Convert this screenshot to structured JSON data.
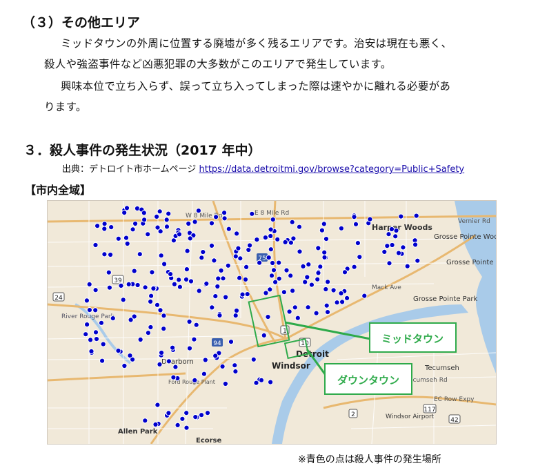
{
  "section3": {
    "heading": "（３）その他エリア",
    "lines": [
      "ミッドタウンの外周に位置する廃墟が多く残るエリアです。治安は現在も悪く、",
      "殺人や強盗事件など凶悪犯罪の大多数がこのエリアで発生しています。",
      "興味本位で立ち入らず、誤って立ち入ってしまった際は速やかに離れる必要があ",
      "ります。"
    ]
  },
  "section_murder": {
    "heading": "３．殺人事件の発生状況（2017 年中）",
    "source_label": "出典：デトロイト市ホームページ",
    "source_url": "https://data.detroitmi.gov/browse?category=Public+Safety",
    "area_label": "【市内全域】"
  },
  "map": {
    "callouts": {
      "midtown": "ミッドタウン",
      "downtown": "ダウンタウン"
    },
    "place_labels": {
      "harper_woods": "Harper Woods",
      "grosse_pointe_woods": "Grosse Pointe Woods",
      "grosse_pointe_farms": "Grosse Pointe Far",
      "grosse_pointe_park": "Grosse Pointe Park",
      "river_rouge": "River Rouge Park",
      "dearborn": "Dearborn",
      "detroit": "Detroit",
      "windsor": "Windsor",
      "windsor_airport": "Windsor Airport",
      "tecumseh": "Tecumseh",
      "allen_park": "Allen Park",
      "ecorse": "Ecorse",
      "ford_rouge": "Ford Rouge Plant",
      "mack_ave": "Mack Ave",
      "e_8_mile": "E 8 Mile Rd",
      "w_8_mile": "W 8 Mile Rd",
      "vernier": "Vernier Rd",
      "ec_row": "EC Row Expy",
      "tecumseh_rd": "Tecumseh Rd"
    },
    "road_shields": {
      "i75": "75",
      "i94": "94",
      "m39": "39",
      "m24": "24",
      "m1": "1",
      "m10": "10",
      "r2": "2",
      "r117": "117",
      "r42": "42"
    },
    "dot_color": "#0000cc",
    "box_color": "#2eaa4a"
  },
  "footnote": "※青色の点は殺人事件の発生場所"
}
